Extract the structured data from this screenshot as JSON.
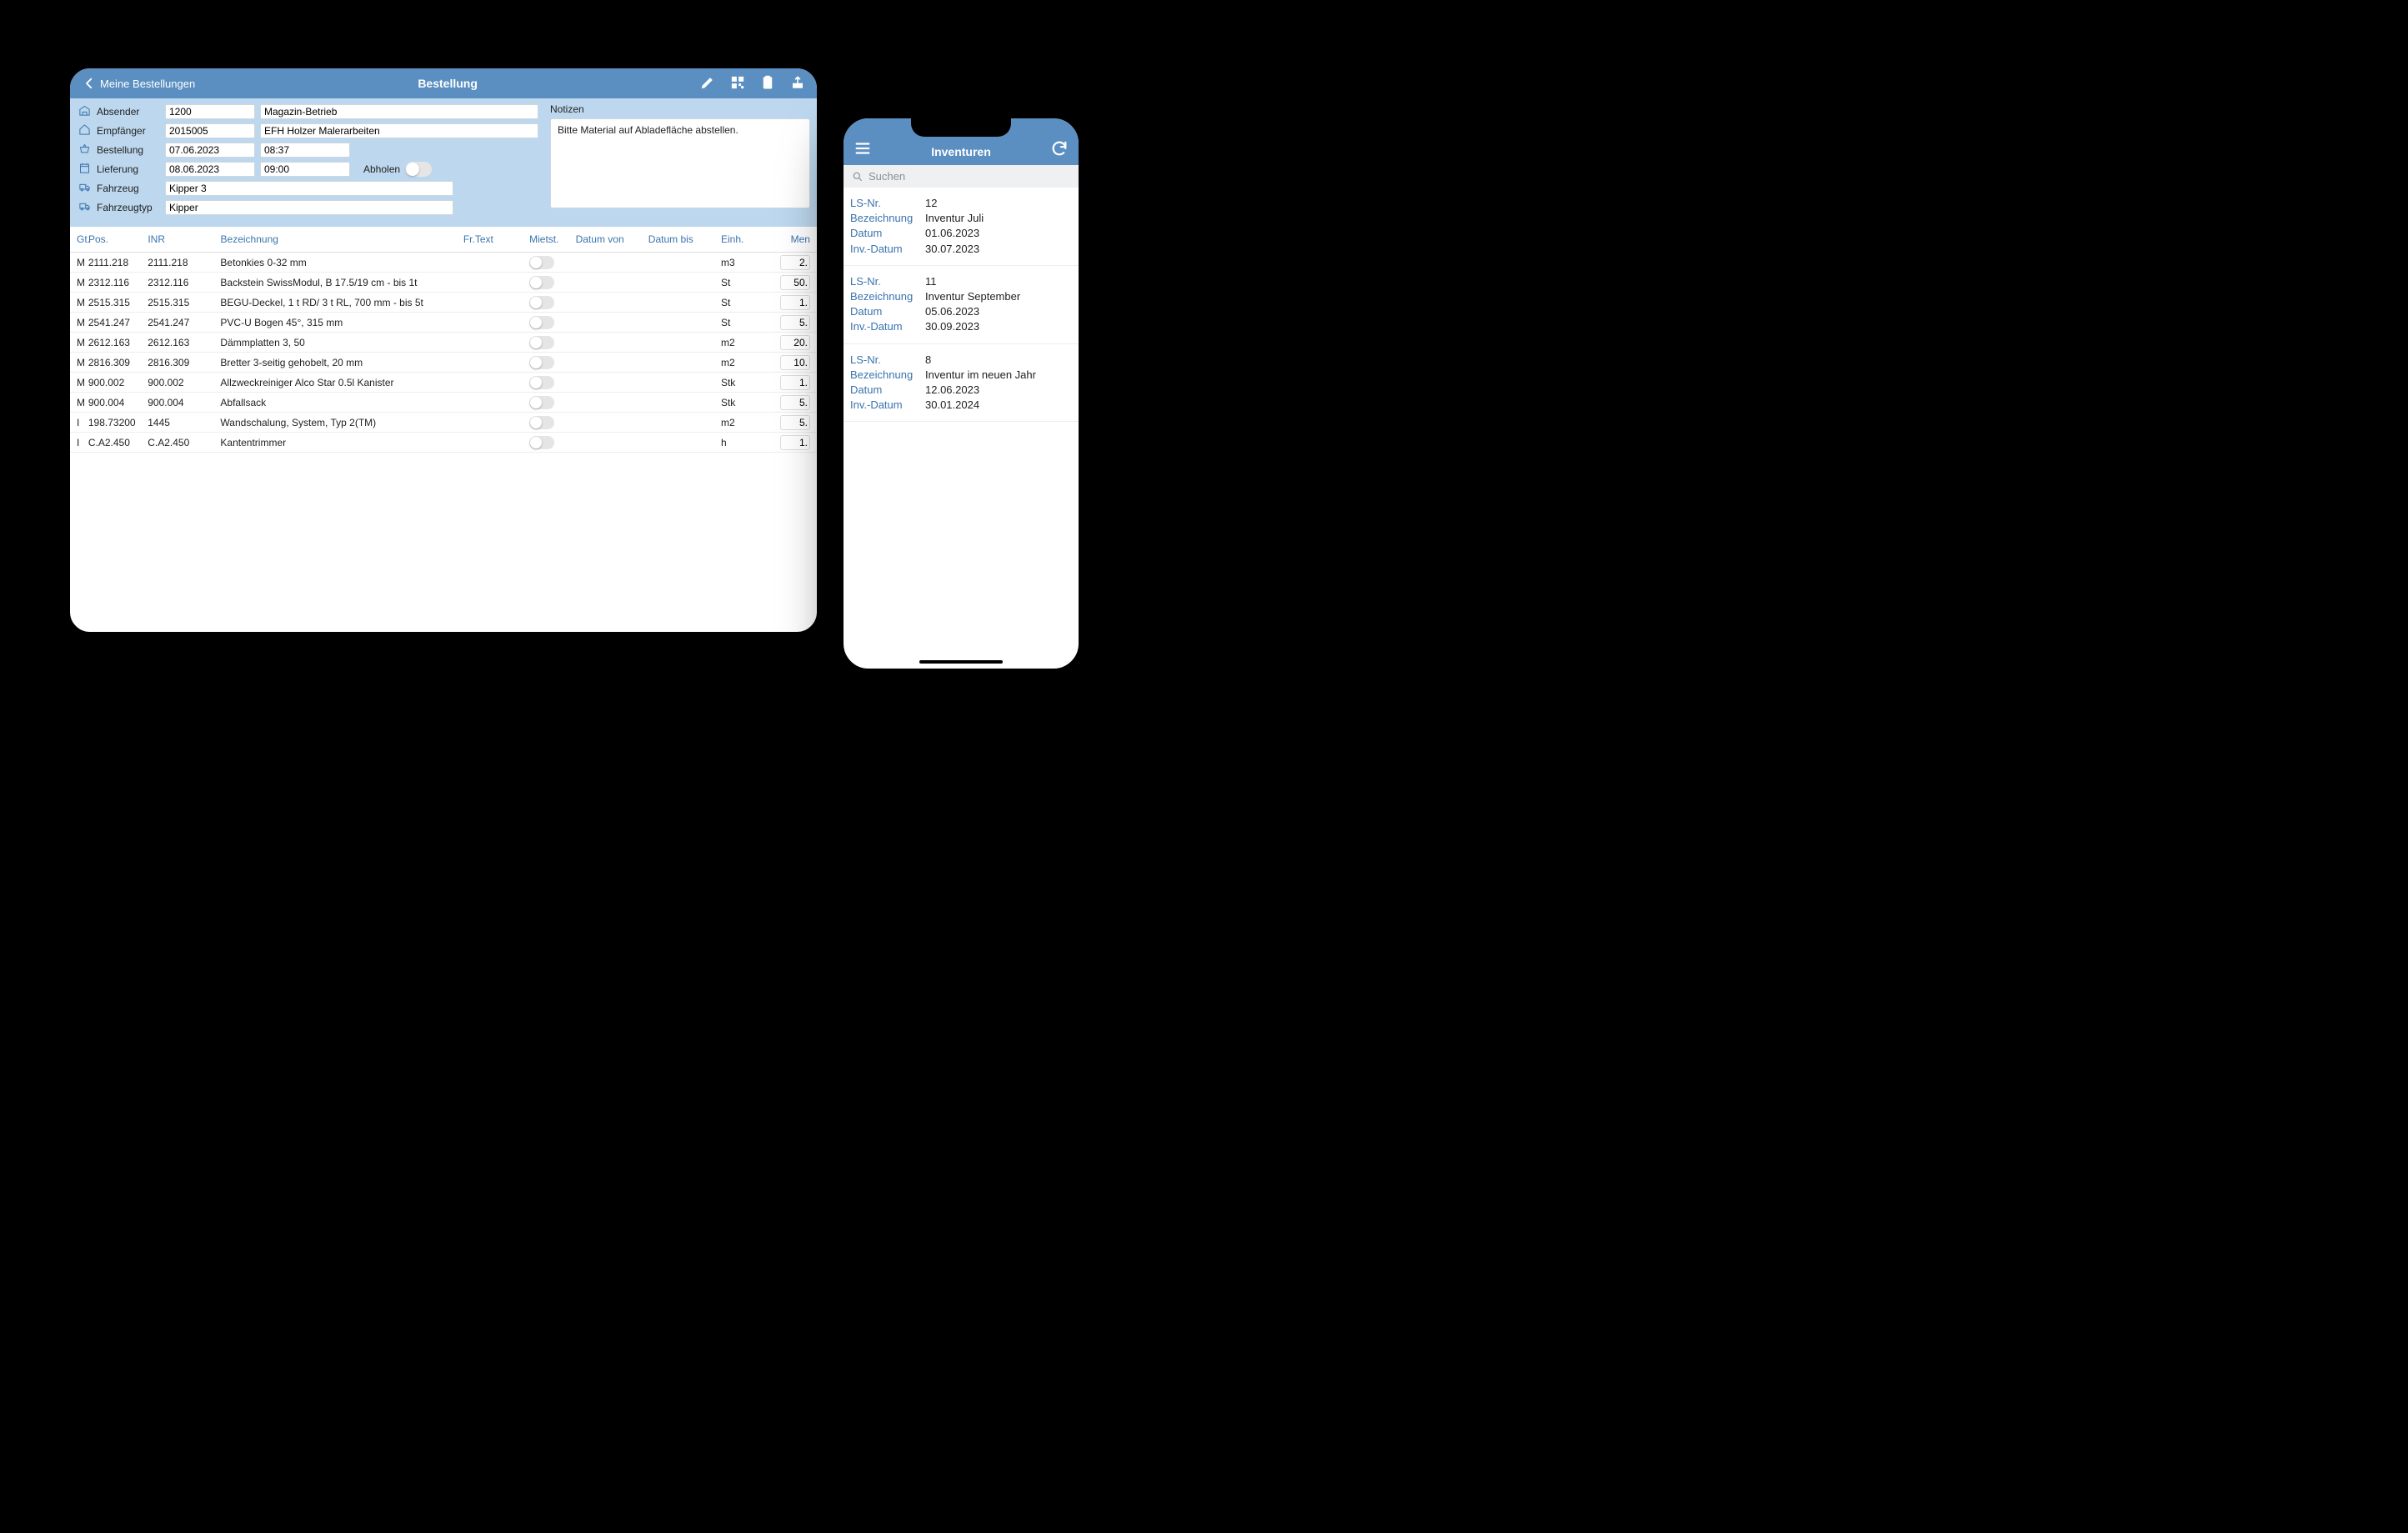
{
  "tablet": {
    "back_label": "Meine Bestellungen",
    "title": "Bestellung",
    "form": {
      "absender_label": "Absender",
      "absender_code": "1200",
      "absender_text": "Magazin-Betrieb",
      "empfaenger_label": "Empfänger",
      "empfaenger_code": "2015005",
      "empfaenger_text": "EFH Holzer Malerarbeiten",
      "bestellung_label": "Bestellung",
      "bestellung_date": "07.06.2023",
      "bestellung_time": "08:37",
      "lieferung_label": "Lieferung",
      "lieferung_date": "08.06.2023",
      "lieferung_time": "09:00",
      "abholen_label": "Abholen",
      "fahrzeug_label": "Fahrzeug",
      "fahrzeug_value": "Kipper 3",
      "fahrzeugtyp_label": "Fahrzeugtyp",
      "fahrzeugtyp_value": "Kipper",
      "notizen_label": "Notizen",
      "notizen_value": "Bitte Material auf Abladefläche abstellen."
    },
    "columns": {
      "gt": "Gt.",
      "pos": "Pos.",
      "inr": "INR",
      "bez": "Bezeichnung",
      "frtext": "Fr.Text",
      "mietst": "Mietst.",
      "datumvon": "Datum von",
      "datumbis": "Datum bis",
      "einh": "Einh.",
      "menge": "Men"
    },
    "rows": [
      {
        "gt": "M",
        "pos": "2111.218",
        "inr": "2111.218",
        "bez": "Betonkies 0-32 mm",
        "einh": "m3",
        "men": "2."
      },
      {
        "gt": "M",
        "pos": "2312.116",
        "inr": "2312.116",
        "bez": "Backstein SwissModul, B 17.5/19 cm - bis 1t",
        "einh": "St",
        "men": "50."
      },
      {
        "gt": "M",
        "pos": "2515.315",
        "inr": "2515.315",
        "bez": "BEGU-Deckel, 1 t RD/  3 t RL, 700 mm - bis 5t",
        "einh": "St",
        "men": "1."
      },
      {
        "gt": "M",
        "pos": "2541.247",
        "inr": "2541.247",
        "bez": "PVC-U Bogen 45°, 315 mm",
        "einh": "St",
        "men": "5."
      },
      {
        "gt": "M",
        "pos": "2612.163",
        "inr": "2612.163",
        "bez": "Dämmplatten 3, 50",
        "einh": "m2",
        "men": "20."
      },
      {
        "gt": "M",
        "pos": "2816.309",
        "inr": "2816.309",
        "bez": "Bretter 3-seitig gehobelt, 20 mm",
        "einh": "m2",
        "men": "10."
      },
      {
        "gt": "M",
        "pos": "900.002",
        "inr": "900.002",
        "bez": "Allzweckreiniger Alco Star 0.5l Kanister",
        "einh": "Stk",
        "men": "1."
      },
      {
        "gt": "M",
        "pos": "900.004",
        "inr": "900.004",
        "bez": "Abfallsack",
        "einh": "Stk",
        "men": "5."
      },
      {
        "gt": "I",
        "pos": "198.73200",
        "inr": "1445",
        "bez": "Wandschalung, System, Typ 2(TM)",
        "einh": "m2",
        "men": "5."
      },
      {
        "gt": "I",
        "pos": "C.A2.450",
        "inr": "C.A2.450",
        "bez": "Kantentrimmer",
        "einh": "h",
        "men": "1."
      }
    ]
  },
  "phone": {
    "title": "Inventuren",
    "search_placeholder": "Suchen",
    "labels": {
      "lsnr": "LS-Nr.",
      "bez": "Bezeichnung",
      "datum": "Datum",
      "invdatum": "Inv.-Datum"
    },
    "cards": [
      {
        "lsnr": "12",
        "bez": "Inventur Juli",
        "datum": "01.06.2023",
        "invdatum": "30.07.2023"
      },
      {
        "lsnr": "11",
        "bez": "Inventur September",
        "datum": "05.06.2023",
        "invdatum": "30.09.2023"
      },
      {
        "lsnr": "8",
        "bez": "Inventur im neuen Jahr",
        "datum": "12.06.2023",
        "invdatum": "30.01.2024"
      }
    ]
  }
}
